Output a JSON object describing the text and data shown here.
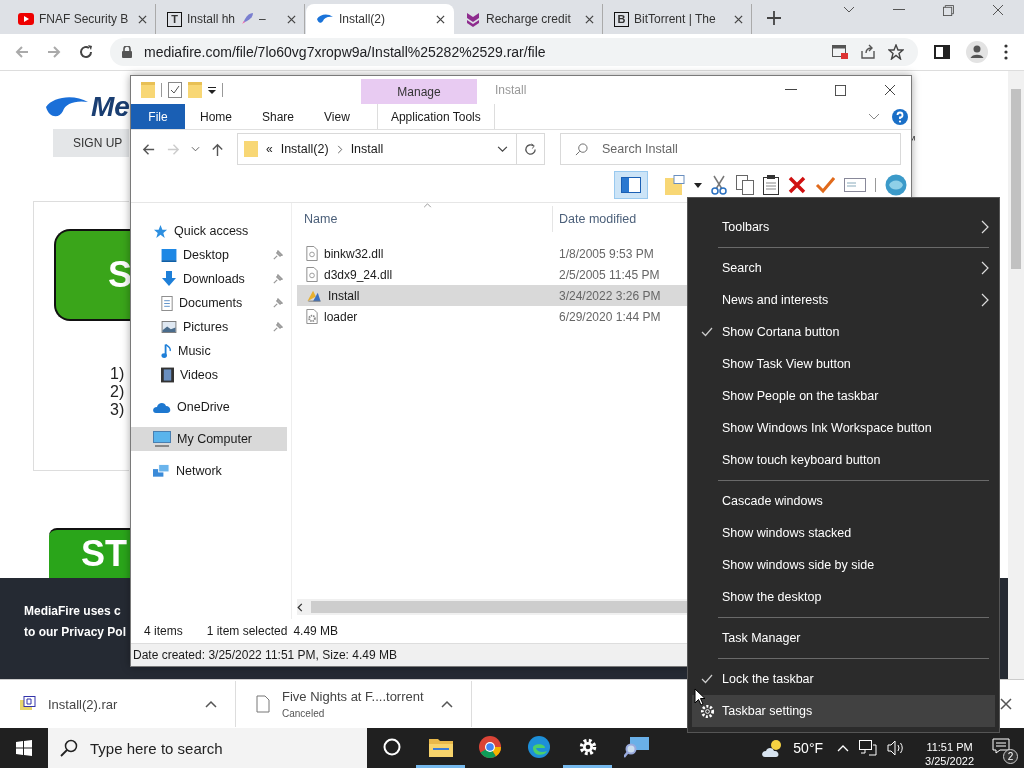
{
  "browser": {
    "tabs": [
      {
        "title": "FNAF Security B",
        "kind": "play",
        "selected": false
      },
      {
        "title": "Install hh",
        "after_icon": "–",
        "kind": "letter",
        "letter": "T",
        "selected": false
      },
      {
        "title": "Install(2)",
        "kind": "flame",
        "selected": true
      },
      {
        "title": "Recharge credit",
        "kind": "chevrons",
        "selected": false
      },
      {
        "title": "BitTorrent | The",
        "kind": "letter",
        "letter": "B",
        "selected": false
      }
    ],
    "url": "mediafire.com/file/7lo60vg7xropw9a/Install%25282%2529.rar/file"
  },
  "page": {
    "logo": "Me",
    "sign_up": "SIGN UP",
    "trademark": "™",
    "button_top": "S",
    "steps": [
      "1)",
      "2)",
      "3)"
    ],
    "button_bottom": "ST",
    "cookie_notice": [
      "MediaFire uses c",
      "to our Privacy Pol"
    ]
  },
  "downloads": [
    {
      "name": "Install(2).rar",
      "kind": "archive"
    },
    {
      "name": "Five Nights at F....torrent",
      "status": "Canceled",
      "kind": "file"
    }
  ],
  "explorer": {
    "title": "Install",
    "contextual_header": "Manage",
    "ribbon_tabs": [
      {
        "label": "File",
        "kind": "file"
      },
      {
        "label": "Home",
        "kind": "plain"
      },
      {
        "label": "Share",
        "kind": "plain"
      },
      {
        "label": "View",
        "kind": "plain"
      },
      {
        "label": "Application Tools",
        "kind": "contextual"
      }
    ],
    "address": {
      "overflow": "«",
      "path": [
        "Install(2)",
        "Install"
      ]
    },
    "search": {
      "placeholder": "Search Install"
    },
    "navigation": [
      {
        "label": "Quick access",
        "kind": "star",
        "selected": false,
        "children": [
          {
            "label": "Desktop",
            "kind": "desktop",
            "pinned": true,
            "selected": false
          },
          {
            "label": "Downloads",
            "kind": "download",
            "pinned": true,
            "selected": false
          },
          {
            "label": "Documents",
            "kind": "document",
            "pinned": true,
            "selected": false
          },
          {
            "label": "Pictures",
            "kind": "picture",
            "pinned": true,
            "selected": false
          },
          {
            "label": "Music",
            "kind": "music",
            "pinned": false,
            "selected": false
          },
          {
            "label": "Videos",
            "kind": "video",
            "pinned": false,
            "selected": false
          }
        ]
      },
      {
        "label": "OneDrive",
        "kind": "cloud",
        "selected": false
      },
      {
        "label": "My Computer",
        "kind": "computer",
        "selected": true
      },
      {
        "label": "Network",
        "kind": "network",
        "selected": false
      }
    ],
    "columns": [
      "Name",
      "Date modified"
    ],
    "files": [
      {
        "name": "binkw32.dll",
        "modified": "1/8/2005 9:53 PM",
        "kind": "dll",
        "selected": false
      },
      {
        "name": "d3dx9_24.dll",
        "modified": "2/5/2005 11:45 PM",
        "kind": "dll",
        "selected": false
      },
      {
        "name": "Install",
        "modified": "3/24/2022 3:26 PM",
        "kind": "app",
        "selected": true
      },
      {
        "name": "loader",
        "modified": "6/29/2020 1:44 PM",
        "kind": "config",
        "selected": false
      }
    ],
    "status": {
      "items": "4 items",
      "selection": "1 item selected",
      "size": "4.49 MB"
    },
    "details": "Date created: 3/25/2022 11:51 PM, Size: 4.49 MB"
  },
  "context_menu": [
    [
      {
        "label": "Toolbars",
        "kind": "submenu",
        "checked": false,
        "highlighted": false
      }
    ],
    [
      {
        "label": "Search",
        "kind": "submenu",
        "checked": false,
        "highlighted": false
      },
      {
        "label": "News and interests",
        "kind": "submenu",
        "checked": false,
        "highlighted": false
      },
      {
        "label": "Show Cortana button",
        "kind": "toggle",
        "checked": true,
        "highlighted": false
      },
      {
        "label": "Show Task View button",
        "kind": "toggle",
        "checked": false,
        "highlighted": false
      },
      {
        "label": "Show People on the taskbar",
        "kind": "toggle",
        "checked": false,
        "highlighted": false
      },
      {
        "label": "Show Windows Ink Workspace button",
        "kind": "toggle",
        "checked": false,
        "highlighted": false
      },
      {
        "label": "Show touch keyboard button",
        "kind": "toggle",
        "checked": false,
        "highlighted": false
      }
    ],
    [
      {
        "label": "Cascade windows",
        "kind": "command",
        "checked": false,
        "highlighted": false
      },
      {
        "label": "Show windows stacked",
        "kind": "command",
        "checked": false,
        "highlighted": false
      },
      {
        "label": "Show windows side by side",
        "kind": "command",
        "checked": false,
        "highlighted": false
      },
      {
        "label": "Show the desktop",
        "kind": "command",
        "checked": false,
        "highlighted": false
      }
    ],
    [
      {
        "label": "Task Manager",
        "kind": "command",
        "checked": false,
        "highlighted": false
      }
    ],
    [
      {
        "label": "Lock the taskbar",
        "kind": "toggle",
        "checked": true,
        "highlighted": false
      },
      {
        "label": "Taskbar settings",
        "kind": "settings",
        "checked": false,
        "highlighted": true
      }
    ]
  ],
  "taskbar": {
    "search_placeholder": "Type here to search",
    "apps": [
      {
        "kind": "cortana",
        "running": false
      },
      {
        "kind": "folder",
        "running": true
      },
      {
        "kind": "chrome",
        "running": false
      },
      {
        "kind": "edge",
        "running": false
      },
      {
        "kind": "gear",
        "running": true
      },
      {
        "kind": "search-pc",
        "running": false
      }
    ],
    "weather": "50°F",
    "time": "11:51 PM",
    "date": "3/25/2022",
    "notifications": "2"
  }
}
